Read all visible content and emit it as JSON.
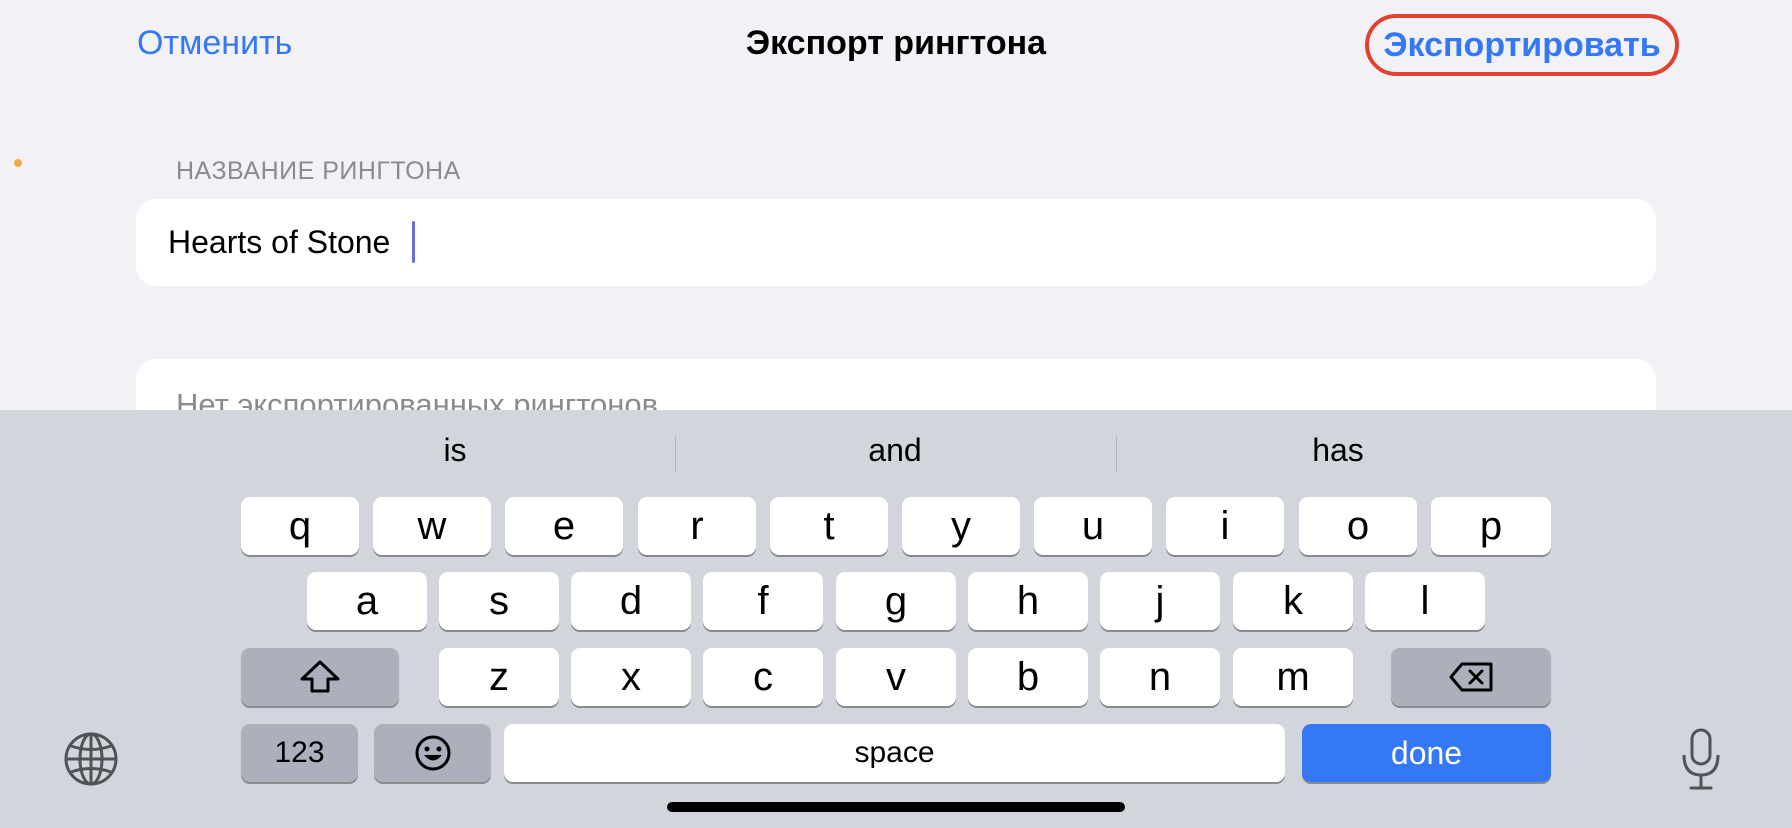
{
  "nav": {
    "cancel": "Отменить",
    "title": "Экспорт рингтона",
    "export": "Экспортировать"
  },
  "form": {
    "section_label": "НАЗВАНИЕ РИНГТОНА",
    "name_value": "Hearts of Stone",
    "empty_list_text": "Нет экспортированных рингтонов"
  },
  "keyboard": {
    "suggestions": [
      "is",
      "and",
      "has"
    ],
    "row1": [
      "q",
      "w",
      "e",
      "r",
      "t",
      "y",
      "u",
      "i",
      "o",
      "p"
    ],
    "row2": [
      "a",
      "s",
      "d",
      "f",
      "g",
      "h",
      "j",
      "k",
      "l"
    ],
    "row3": [
      "z",
      "x",
      "c",
      "v",
      "b",
      "n",
      "m"
    ],
    "numbers_key": "123",
    "space_key": "space",
    "done_key": "done",
    "icons": [
      "shift-icon",
      "backspace-icon",
      "emoji-icon",
      "globe-icon",
      "microphone-icon"
    ]
  },
  "colors": {
    "accent": "#3478f6",
    "highlight_ring": "#e2412f",
    "caret": "#6a6ce0"
  }
}
